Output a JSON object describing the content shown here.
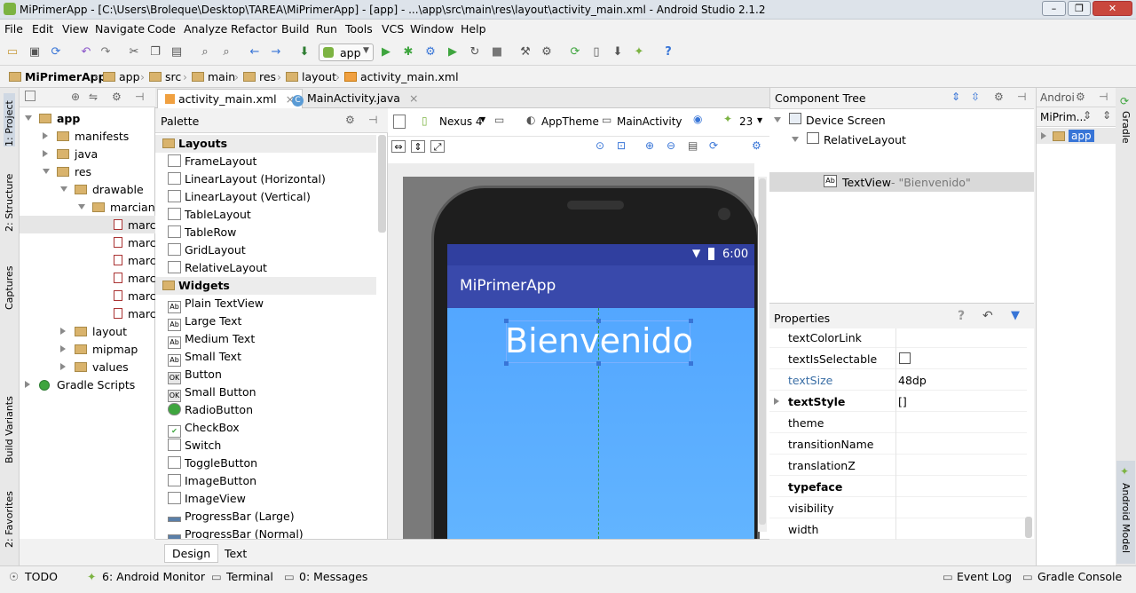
{
  "window": {
    "title": "MiPrimerApp - [C:\\Users\\Broleque\\Desktop\\TAREA\\MiPrimerApp] - [app] - ...\\app\\src\\main\\res\\layout\\activity_main.xml - Android Studio 2.1.2"
  },
  "menu": [
    "File",
    "Edit",
    "View",
    "Navigate",
    "Code",
    "Analyze",
    "Refactor",
    "Build",
    "Run",
    "Tools",
    "VCS",
    "Window",
    "Help"
  ],
  "toolbar": {
    "run_config": "app"
  },
  "breadcrumb": [
    "MiPrimerApp",
    "app",
    "src",
    "main",
    "res",
    "layout",
    "activity_main.xml"
  ],
  "left_tools": [
    "1: Project",
    "2: Structure",
    "Captures",
    "Build Variants",
    "2: Favorites"
  ],
  "project_tree": [
    {
      "label": "app",
      "level": 0,
      "open": true,
      "bold": true
    },
    {
      "label": "manifests",
      "level": 1,
      "open": false
    },
    {
      "label": "java",
      "level": 1,
      "open": false
    },
    {
      "label": "res",
      "level": 1,
      "open": true
    },
    {
      "label": "drawable",
      "level": 2,
      "open": true
    },
    {
      "label": "marcianito",
      "level": 3,
      "open": true
    },
    {
      "label": "marcia",
      "level": 4,
      "file": true
    },
    {
      "label": "marcia",
      "level": 4,
      "file": true
    },
    {
      "label": "marcia",
      "level": 4,
      "file": true
    },
    {
      "label": "marcia",
      "level": 4,
      "file": true
    },
    {
      "label": "marcia",
      "level": 4,
      "file": true
    },
    {
      "label": "marcia",
      "level": 4,
      "file": true
    },
    {
      "label": "layout",
      "level": 2,
      "open": false
    },
    {
      "label": "mipmap",
      "level": 2,
      "open": false
    },
    {
      "label": "values",
      "level": 2,
      "open": false
    },
    {
      "label": "Gradle Scripts",
      "level": 0,
      "open": false
    }
  ],
  "editor_tabs": [
    "activity_main.xml",
    "MainActivity.java"
  ],
  "palette": {
    "title": "Palette",
    "sections": [
      {
        "name": "Layouts",
        "items": [
          "FrameLayout",
          "LinearLayout (Horizontal)",
          "LinearLayout (Vertical)",
          "TableLayout",
          "TableRow",
          "GridLayout",
          "RelativeLayout"
        ]
      },
      {
        "name": "Widgets",
        "items": [
          "Plain TextView",
          "Large Text",
          "Medium Text",
          "Small Text",
          "Button",
          "Small Button",
          "RadioButton",
          "CheckBox",
          "Switch",
          "ToggleButton",
          "ImageButton",
          "ImageView",
          "ProgressBar (Large)",
          "ProgressBar (Normal)"
        ]
      }
    ]
  },
  "design_toolbar": {
    "device": "Nexus 4",
    "theme": "AppTheme",
    "activity": "MainActivity",
    "api": "23"
  },
  "phone": {
    "time": "6:00",
    "app_title": "MiPrimerApp",
    "text": "Bienvenido"
  },
  "design_tabs": [
    "Design",
    "Text"
  ],
  "component_tree": {
    "title": "Component Tree",
    "nodes": [
      {
        "label": "Device Screen",
        "level": 0
      },
      {
        "label": "RelativeLayout",
        "level": 1
      },
      {
        "label": "TextView",
        "suffix": " - \"Bienvenido\"",
        "level": 2
      }
    ]
  },
  "properties": {
    "title": "Properties",
    "rows": [
      {
        "name": "textColorLink",
        "value": ""
      },
      {
        "name": "textIsSelectable",
        "value": ""
      },
      {
        "name": "textSize",
        "value": "48dp"
      },
      {
        "name": "textStyle",
        "value": "[]"
      },
      {
        "name": "theme",
        "value": ""
      },
      {
        "name": "transitionName",
        "value": ""
      },
      {
        "name": "translationZ",
        "value": ""
      },
      {
        "name": "typeface",
        "value": ""
      },
      {
        "name": "visibility",
        "value": ""
      },
      {
        "name": "width",
        "value": ""
      }
    ]
  },
  "right_panel": {
    "header": "Androi",
    "node": "MiPrim...",
    "app": "app"
  },
  "right_tools": [
    "Gradle",
    "Android Model"
  ],
  "status_tabs": [
    "TODO",
    "6: Android Monitor",
    "Terminal",
    "0: Messages",
    "Event Log",
    "Gradle Console"
  ],
  "colors": {
    "accent": "#3875d7",
    "phone_toolbar": "#3949ab",
    "phone_bg": "#4fa3ff"
  }
}
